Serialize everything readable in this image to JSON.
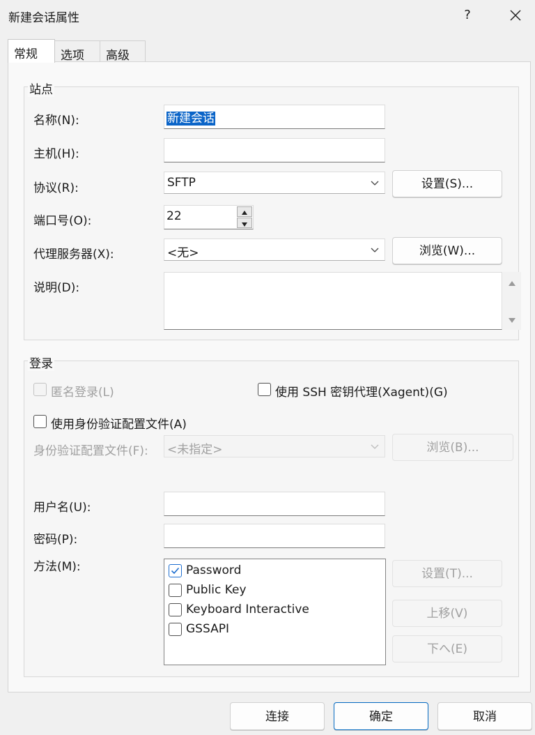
{
  "window": {
    "title": "新建会话属性",
    "help": "?"
  },
  "tabs": [
    {
      "label": "常规",
      "active": true
    },
    {
      "label": "选项",
      "active": false
    },
    {
      "label": "高级",
      "active": false
    }
  ],
  "site": {
    "group_title": "站点",
    "name_label": "名称(N):",
    "name_value": "新建会话",
    "host_label": "主机(H):",
    "host_value": "",
    "protocol_label": "协议(R):",
    "protocol_value": "SFTP",
    "protocol_settings_button": "设置(S)...",
    "port_label": "端口号(O):",
    "port_value": "22",
    "proxy_label": "代理服务器(X):",
    "proxy_value": "<无>",
    "proxy_browse_button": "浏览(W)...",
    "description_label": "说明(D):",
    "description_value": ""
  },
  "login": {
    "group_title": "登录",
    "anonymous_label": "匿名登录(L)",
    "anonymous_checked": false,
    "anonymous_enabled": false,
    "xagent_label": "使用 SSH 密钥代理(Xagent)(G)",
    "xagent_checked": false,
    "use_profile_label": "使用身份验证配置文件(A)",
    "use_profile_checked": false,
    "profile_label": "身份验证配置文件(F):",
    "profile_value": "<未指定>",
    "profile_browse_button": "浏览(B)...",
    "username_label": "用户名(U):",
    "username_value": "",
    "password_label": "密码(P):",
    "password_value": "",
    "method_label": "方法(M):",
    "methods": [
      {
        "label": "Password",
        "checked": true
      },
      {
        "label": "Public Key",
        "checked": false
      },
      {
        "label": "Keyboard Interactive",
        "checked": false
      },
      {
        "label": "GSSAPI",
        "checked": false
      }
    ],
    "method_settings_button": "设置(T)...",
    "move_up_button": "上移(V)",
    "move_down_button": "下へ(E)"
  },
  "footer": {
    "connect_button": "连接",
    "ok_button": "确定",
    "cancel_button": "取消"
  },
  "colors": {
    "accent": "#1f6fd0",
    "selection": "#0a64c8",
    "disabled_text": "#a0a0a0"
  }
}
